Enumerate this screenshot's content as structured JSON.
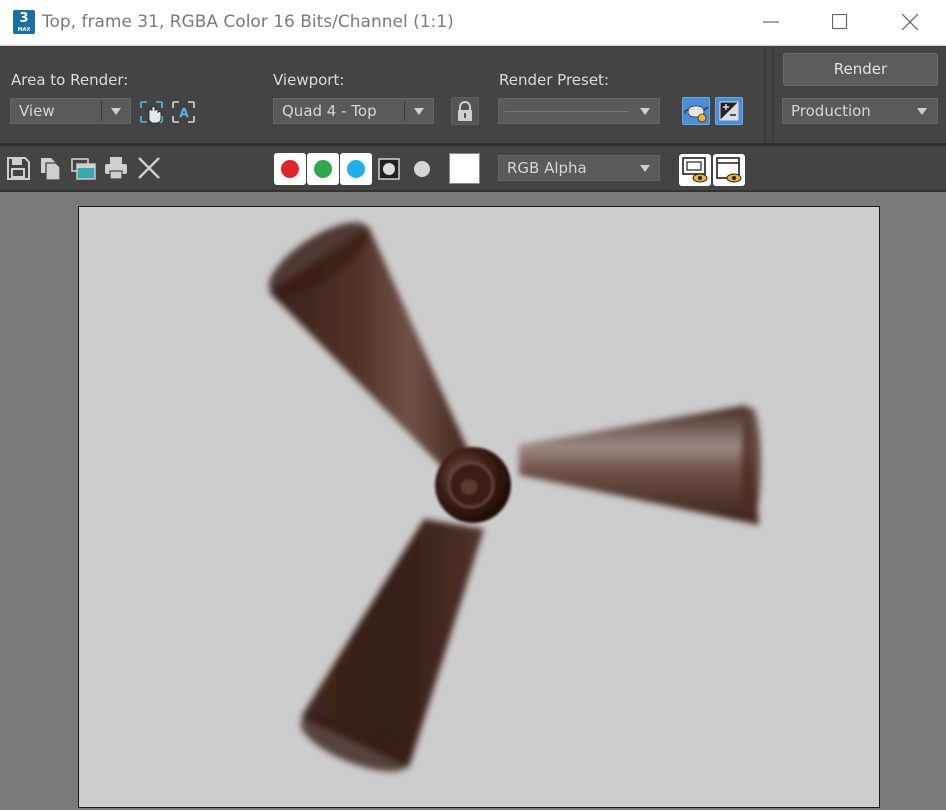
{
  "window": {
    "title": "Top, frame 31, RGBA Color 16 Bits/Channel (1:1)",
    "app_icon_text": "3",
    "app_icon_subtext": "MAX"
  },
  "controls": {
    "area_to_render": {
      "label": "Area to Render:",
      "value": "View"
    },
    "viewport": {
      "label": "Viewport:",
      "value": "Quad 4 - Top"
    },
    "render_preset": {
      "label": "Render Preset:",
      "value": ""
    },
    "render_button": "Render",
    "production": {
      "value": "Production"
    }
  },
  "toolbar": {
    "channel_display": {
      "value": "RGB Alpha"
    }
  },
  "colors": {
    "red_channel": "#e0242c",
    "green_channel": "#2fa84a",
    "blue_channel": "#1fb0ea",
    "accent_active": "#4a8fd6",
    "render_background": "#cdcdcd",
    "blade_color": "#3e2218"
  }
}
